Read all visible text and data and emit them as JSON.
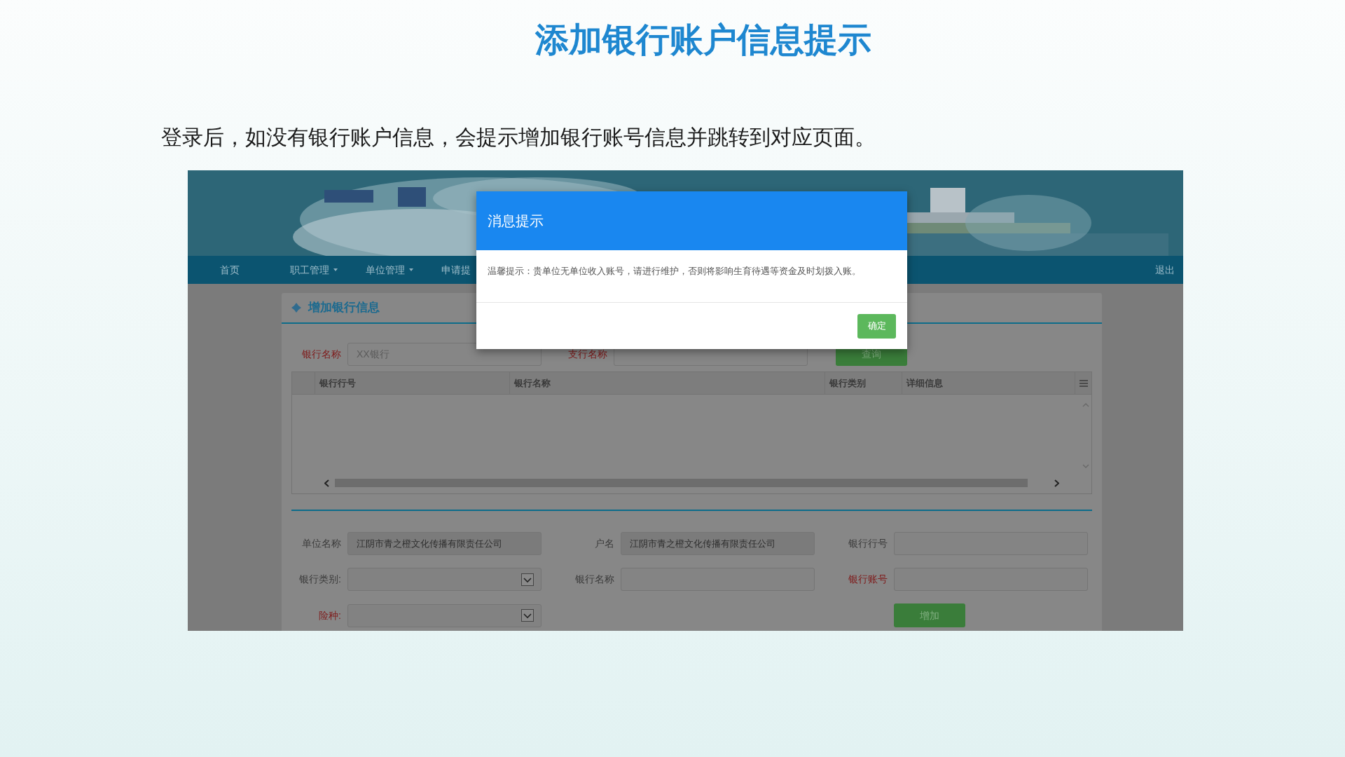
{
  "slide": {
    "title": "添加银行账户信息提示",
    "description": "登录后，如没有银行账户信息，会提示增加银行账号信息并跳转到对应页面。"
  },
  "screen": {
    "nav": {
      "items": [
        {
          "label": "首页",
          "dropdown": false
        },
        {
          "label": "职工管理",
          "dropdown": true
        },
        {
          "label": "单位管理",
          "dropdown": true
        },
        {
          "label": "申请提",
          "dropdown": false
        }
      ],
      "logout": "退出"
    },
    "card": {
      "title": "增加银行信息"
    },
    "search": {
      "fields": [
        {
          "label": "银行名称",
          "required": true,
          "placeholder": "XX银行"
        },
        {
          "label": "支行名称",
          "required": true
        }
      ],
      "button": "查询"
    },
    "table": {
      "columns": [
        "银行行号",
        "银行名称",
        "银行类别",
        "详细信息"
      ]
    },
    "form": {
      "fields": [
        {
          "label": "单位名称",
          "kind": "text",
          "required": false,
          "value": "江阴市青之橙文化传播有限责任公司"
        },
        {
          "label": "户名",
          "kind": "text",
          "required": false,
          "value": "江阴市青之橙文化传播有限责任公司"
        },
        {
          "label": "银行行号",
          "kind": "text",
          "required": false
        },
        {
          "label": "银行类别:",
          "kind": "select",
          "required": false
        },
        {
          "label": "银行名称",
          "kind": "text",
          "required": false
        },
        {
          "label": "银行账号",
          "kind": "text",
          "required": true
        },
        {
          "label": "险种:",
          "kind": "select",
          "required": true
        }
      ],
      "button": "增加"
    },
    "dialog": {
      "title": "消息提示",
      "message": "温馨提示：贵单位无单位收入账号，请进行维护，否则将影响生育待遇等资金及时划拨入账。",
      "button": "确定"
    }
  }
}
